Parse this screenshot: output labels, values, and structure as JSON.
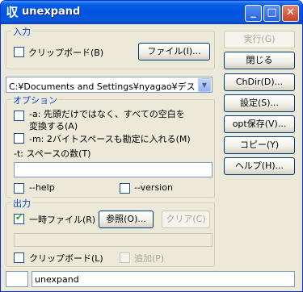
{
  "window": {
    "title": "unexpand",
    "app_icon": "収"
  },
  "input_group": {
    "legend": "入力",
    "clipboard_label": "クリップボード(B)",
    "file_button": "ファイル(I)...",
    "path_value": "C:¥Documents and Settings¥nyagao¥デス"
  },
  "right_buttons": {
    "run": "実行(G)",
    "close": "閉じる",
    "chdir": "ChDir(D)...",
    "settings": "設定(S)...",
    "opt_save": "opt保存(V)...",
    "copy": "コピー(Y)",
    "help": "ヘルプ(H)..."
  },
  "options_group": {
    "legend": "オプション",
    "a_line1": "-a: 先頭だけではなく、すべての空白を",
    "a_line2": "変換する(A)",
    "m_label": "-m: 2バイトスペースも勘定に入れる(M)",
    "t_label": "-t: スペースの数(T)",
    "t_value": "",
    "help_label": "--help",
    "version_label": "--version"
  },
  "output_group": {
    "legend": "出力",
    "tempfile_label": "一時ファイル(R)",
    "tempfile_checked": true,
    "browse_button": "参照(O)...",
    "clear_button": "クリア(C)",
    "output_path": "",
    "clipboard_label": "クリップボード(L)",
    "append_label": "追加(P)"
  },
  "status": {
    "command": "unexpand"
  }
}
